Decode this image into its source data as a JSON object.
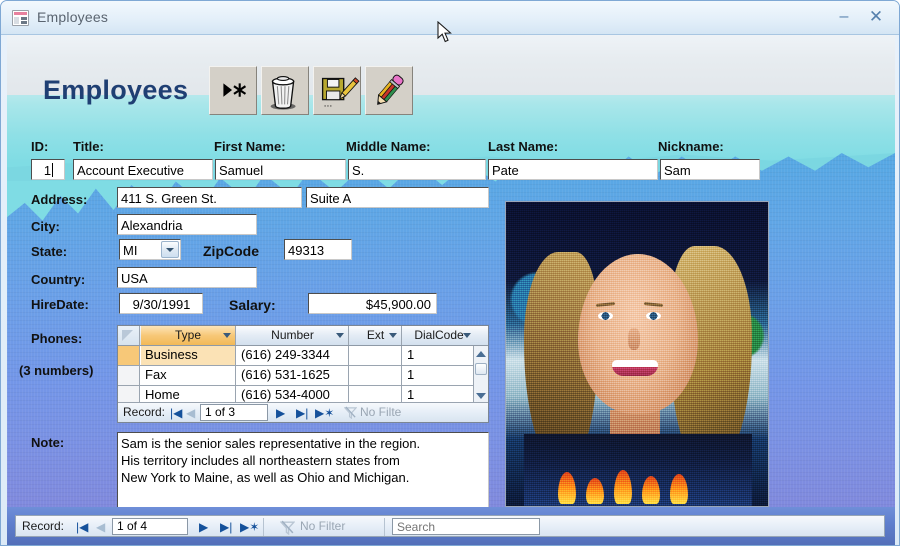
{
  "window": {
    "title": "Employees",
    "icon": "access-form-icon",
    "minimize_label": "–",
    "close_label": "✕"
  },
  "form": {
    "header_title": "Employees",
    "toolbar": [
      {
        "name": "new-record-button",
        "icon": "new-record-icon",
        "tooltip": "New Record"
      },
      {
        "name": "delete-record-button",
        "icon": "trash-can-icon",
        "tooltip": "Delete Record"
      },
      {
        "name": "save-record-button",
        "icon": "save-pencil-icon",
        "tooltip": "Save Record"
      },
      {
        "name": "edit-record-button",
        "icon": "pencil-eraser-icon",
        "tooltip": "Edit Record"
      }
    ]
  },
  "fields": {
    "id": {
      "label": "ID:",
      "value": "1"
    },
    "title": {
      "label": "Title:",
      "value": "Account Executive"
    },
    "first_name": {
      "label": "First Name:",
      "value": "Samuel"
    },
    "middle_name": {
      "label": "Middle Name:",
      "value": "S."
    },
    "last_name": {
      "label": "Last Name:",
      "value": "Pate"
    },
    "nickname": {
      "label": "Nickname:",
      "value": "Sam"
    },
    "address": {
      "label": "Address:",
      "value": "411 S. Green St."
    },
    "address2": {
      "value": "Suite A"
    },
    "city": {
      "label": "City:",
      "value": "Alexandria"
    },
    "state": {
      "label": "State:",
      "value": "MI",
      "options": [
        "MI"
      ]
    },
    "zipcode": {
      "label": "ZipCode",
      "value": "49313"
    },
    "country": {
      "label": "Country:",
      "value": "USA"
    },
    "hiredate": {
      "label": "HireDate:",
      "value": "9/30/1991"
    },
    "salary": {
      "label": "Salary:",
      "value": "$45,900.00"
    },
    "note": {
      "label": "Note:",
      "value": "Sam is the senior sales representative in the region.\nHis territory includes all northeastern states from\nNew York to Maine, as well as Ohio and Michigan."
    }
  },
  "photo": {
    "name": "employee-photo",
    "alt": "Employee portrait photograph"
  },
  "phones": {
    "label": "Phones:",
    "count_label": "(3 numbers)",
    "columns": [
      "Type",
      "Number",
      "Ext",
      "DialCode"
    ],
    "selected_column": "Type",
    "rows": [
      {
        "type": "Business",
        "number": "(616) 249-3344",
        "ext": "",
        "dialcode": "1"
      },
      {
        "type": "Fax",
        "number": "(616) 531-1625",
        "ext": "",
        "dialcode": "1"
      },
      {
        "type": "Home",
        "number": "(616) 534-4000",
        "ext": "",
        "dialcode": "1"
      }
    ],
    "nav": {
      "record_label": "Record:",
      "position": "1 of 3",
      "first_label": "|◀",
      "prev_label": "◀",
      "next_label": "▶",
      "last_label": "▶|",
      "new_label": "▶✶",
      "filter_label": "No Filte"
    }
  },
  "main_nav": {
    "record_label": "Record:",
    "position": "1 of 4",
    "first_label": "|◀",
    "prev_label": "◀",
    "next_label": "▶",
    "last_label": "▶|",
    "new_label": "▶✶",
    "filter_label": "No Filter",
    "search_placeholder": "Search",
    "search_value": ""
  },
  "colors": {
    "title_text": "#1f3f73",
    "wallpaper_sky": "#a8e6ea",
    "wallpaper_mountain": "#6b9fe8",
    "statusbar": "#5f7fce",
    "selected_column": "#f7c878",
    "nav_arrow": "#15519b"
  }
}
